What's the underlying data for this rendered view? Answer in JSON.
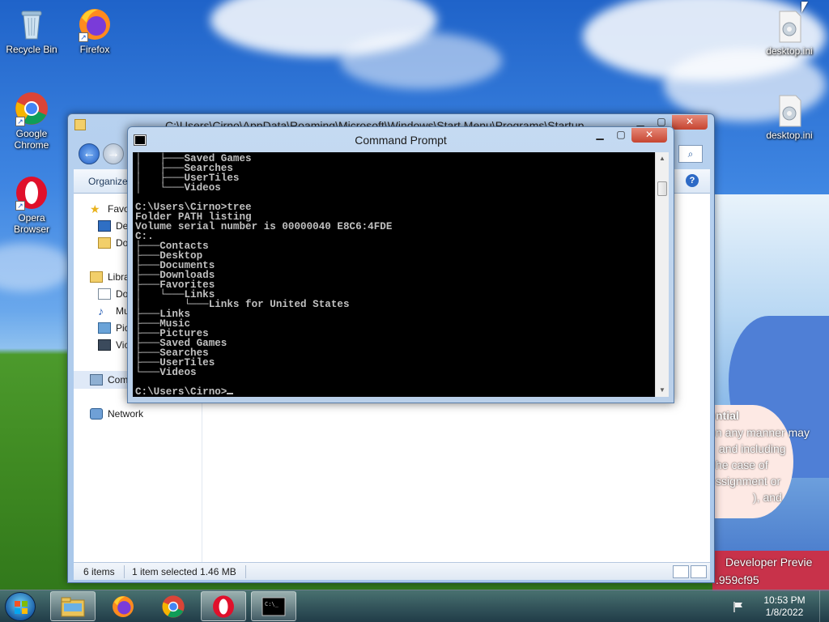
{
  "desktop": {
    "icons": [
      {
        "label": "Recycle Bin",
        "icon": "recycle-bin-icon"
      },
      {
        "label": "Firefox",
        "icon": "firefox-icon"
      },
      {
        "label": "Google Chrome",
        "icon": "chrome-icon"
      },
      {
        "label": "Opera Browser",
        "icon": "opera-icon"
      },
      {
        "label": "desktop.ini",
        "icon": "settings-file-icon"
      },
      {
        "label": "desktop.ini",
        "icon": "settings-file-icon"
      }
    ],
    "wallpaper_text": {
      "line1": "ntial",
      "line2": "n any manner may",
      "line3": "and including",
      "line4": "he case of",
      "line5": "ssignment or",
      "line6": "), and",
      "line7": "Developer Previe",
      "line8": ".959cf95"
    }
  },
  "explorer": {
    "title": "C:\\Users\\Cirno\\AppData\\Roaming\\Microsoft\\Windows\\Start Menu\\Programs\\Startup",
    "organize": "Organize",
    "nav": {
      "favorites": "Favo",
      "desktop": "De",
      "downloads": "Do",
      "libraries": "Libra",
      "documents": "Do",
      "music": "Mu",
      "pictures": "Pic",
      "videos": "Vic",
      "computer": "Com",
      "network": "Network"
    },
    "status": {
      "items": "6 items",
      "selected": "1 item selected  1.46 MB"
    }
  },
  "cmd": {
    "title": "Command Prompt",
    "output": "│   ├───Saved Games\n│   ├───Searches\n│   ├───UserTiles\n│   └───Videos\n\nC:\\Users\\Cirno>tree\nFolder PATH listing\nVolume serial number is 00000040 E8C6:4FDE\nC:.\n├───Contacts\n├───Desktop\n├───Documents\n├───Downloads\n├───Favorites\n│   └───Links\n│       └───Links for United States\n├───Links\n├───Music\n├───Pictures\n├───Saved Games\n├───Searches\n├───UserTiles\n└───Videos\n\nC:\\Users\\Cirno>"
  },
  "taskbar": {
    "items": [
      {
        "name": "explorer",
        "icon": "folder-icon"
      },
      {
        "name": "firefox",
        "icon": "firefox-icon"
      },
      {
        "name": "chrome",
        "icon": "chrome-icon"
      },
      {
        "name": "opera",
        "icon": "opera-icon"
      },
      {
        "name": "cmd",
        "icon": "cmd-icon"
      }
    ],
    "time": "10:53 PM",
    "date": "1/8/2022"
  },
  "colors": {
    "console_bg": "#000000",
    "console_fg": "#c0c0c0",
    "close_button": "#c64531"
  }
}
